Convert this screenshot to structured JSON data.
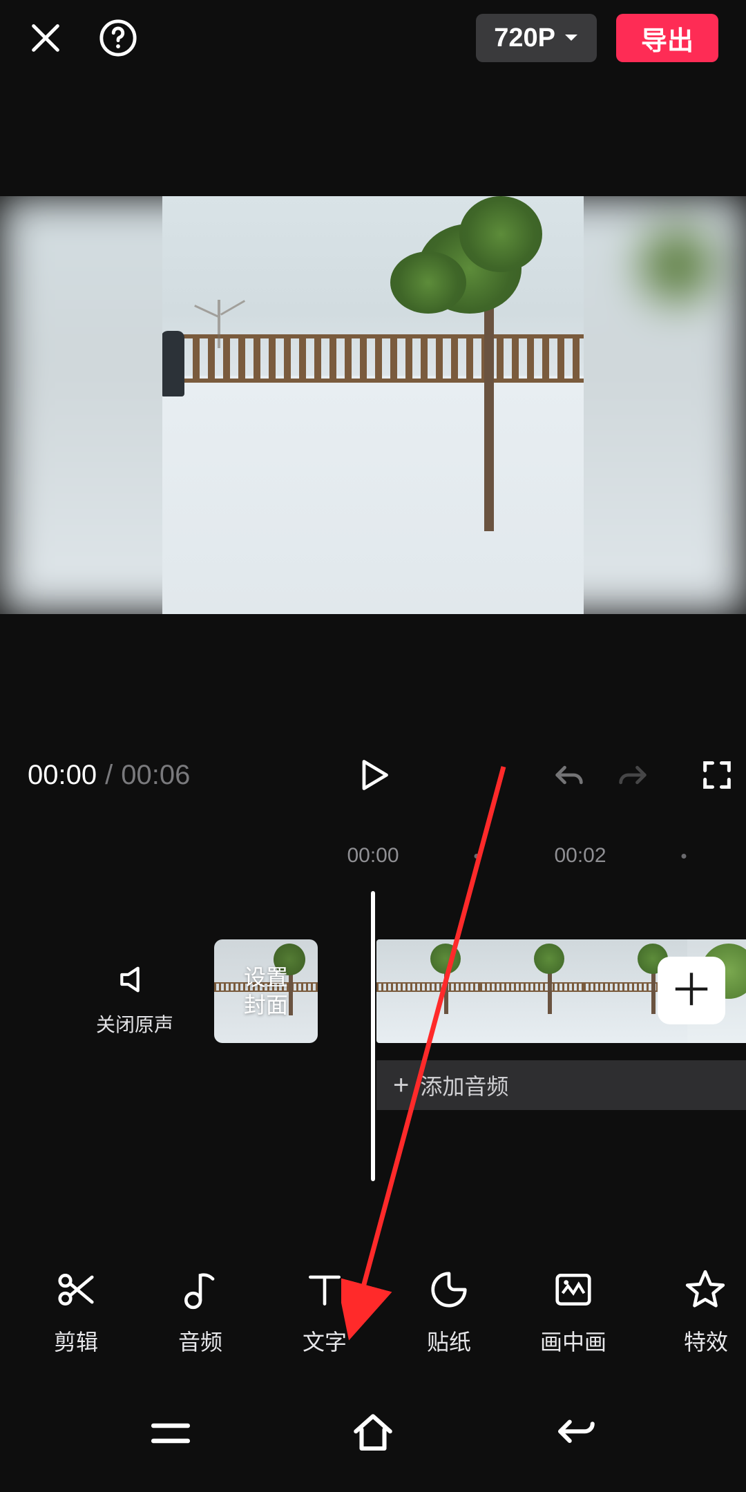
{
  "header": {
    "resolution_label": "720P",
    "export_label": "导出"
  },
  "playback": {
    "current_time": "00:00",
    "total_time": "00:06"
  },
  "ruler": {
    "ticks": [
      "00:00",
      "00:02"
    ]
  },
  "timeline": {
    "mute_label": "关闭原声",
    "cover_label": "设置\n封面",
    "add_audio_label": "添加音频"
  },
  "tools": [
    {
      "id": "edit",
      "label": "剪辑"
    },
    {
      "id": "audio",
      "label": "音频"
    },
    {
      "id": "text",
      "label": "文字"
    },
    {
      "id": "sticker",
      "label": "贴纸"
    },
    {
      "id": "pip",
      "label": "画中画"
    },
    {
      "id": "effects",
      "label": "特效"
    }
  ],
  "colors": {
    "accent": "#fe2c55",
    "annotation_arrow": "#ff2a2a"
  }
}
